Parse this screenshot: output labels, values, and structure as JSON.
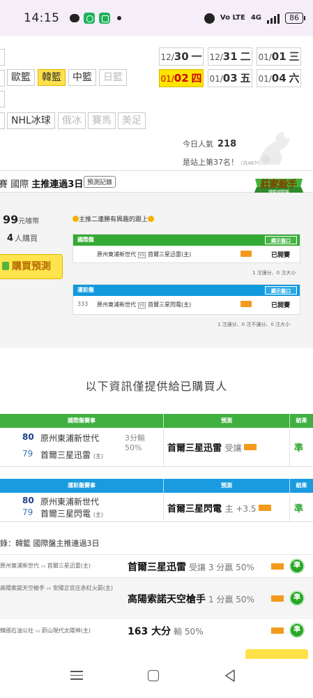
{
  "status_bar": {
    "time": "14:15",
    "net": "Vo LTE",
    "signal": "4G",
    "battery": "86"
  },
  "categories": {
    "row1": [
      {
        "label": "歐籃",
        "state": "normal"
      },
      {
        "label": "韓籃",
        "state": "active"
      },
      {
        "label": "中籃",
        "state": "normal"
      },
      {
        "label": "日籃",
        "state": "disabled"
      }
    ],
    "row3": [
      {
        "label": "NHL冰球",
        "state": "normal"
      },
      {
        "label": "俄冰",
        "state": "disabled"
      },
      {
        "label": "賽馬",
        "state": "disabled"
      },
      {
        "label": "美足",
        "state": "disabled"
      }
    ]
  },
  "dates": [
    {
      "md": "12/",
      "day": "30",
      "wd": "一",
      "active": false
    },
    {
      "md": "12/",
      "day": "31",
      "wd": "二",
      "active": false
    },
    {
      "md": "01/",
      "day": "01",
      "wd": "三",
      "active": false
    },
    {
      "md": "01/",
      "day": "02",
      "wd": "四",
      "active": true
    },
    {
      "md": "01/",
      "day": "03",
      "wd": "五",
      "active": false
    },
    {
      "md": "01/",
      "day": "04",
      "wd": "六",
      "active": false
    }
  ],
  "popularity": {
    "label": "今日人氣",
    "value": "218",
    "rank": "是站上第37名！",
    "rank_sub": "(共4670人)"
  },
  "package": {
    "prefix": "賽 國際",
    "title": "主推連過3日",
    "record_label": "預測記錄",
    "badge_title": "莊家殺手",
    "badge_sub": "韓籃國際盤",
    "price": "99",
    "price_unit": "元噱幣",
    "buyers": "4",
    "buyers_unit": "人購買",
    "buy_label": "購買預測",
    "tagline": "主推二連勝有興趣的跟上",
    "intl": {
      "label": "國際盤",
      "show_label": "顯示盤口",
      "id": "",
      "home": "原州東浦新世代",
      "away": "首爾三星迅雷(主)",
      "status": "已開賽",
      "note": "1 注讓分、0 注大小"
    },
    "lottery": {
      "label": "運彩盤",
      "show_label": "顯示盤口",
      "id": "333",
      "home": "原州東浦新世代",
      "away": "首爾三星閃電(主)",
      "status": "已開賽",
      "note": "1 注讓分、0 注不讓分、0 注大小"
    }
  },
  "notice": "以下資訊僅提供給已購買人",
  "table_headers": {
    "match": "賽事",
    "pick": "預測",
    "result": "結果"
  },
  "intl_table": {
    "title": "國際盤賽事",
    "rows": [
      {
        "num_a": "80",
        "team_a": "原州東浦新世代",
        "num_b": "79",
        "team_b": "首爾三星迅雷",
        "host": "(主)",
        "score": "3分輸",
        "pct": "50%",
        "pick": "首爾三星迅雷",
        "pick_note": "受讓",
        "result": "準"
      }
    ]
  },
  "lottery_table": {
    "title": "運彩盤賽事",
    "rows": [
      {
        "num_a": "80",
        "team_a": "原州東浦新世代",
        "num_b": "79",
        "team_b": "首爾三星閃電",
        "host": "(主)",
        "pick": "首爾三星閃電",
        "pick_note": "主 +3.5",
        "result": "準"
      }
    ]
  },
  "history": {
    "title": "錄：韓籃 國際盤主推連過3日",
    "rows": [
      {
        "match": "原州東浦新世代",
        "vs": "vs",
        "match2": "首爾三星迅雷(主)",
        "pick": "首爾三星迅雷",
        "note": "受讓 3 分贏 50%",
        "result": "準"
      },
      {
        "match": "高陽索諾天空槍手",
        "vs": "vs",
        "match2": "安陽正官庄赤紅火箭(主)",
        "pick": "高陽索諾天空槍手",
        "note": "1 分贏 50%",
        "result": "準"
      },
      {
        "match": "韓國石油公社",
        "vs": "vs",
        "match2": "蔚山現代太陽神(主)",
        "pick": "163 大分",
        "note": "輸 50%",
        "result": "準"
      }
    ]
  },
  "colors": {
    "accent_yellow": "#ffe14a",
    "green": "#3fb040",
    "blue": "#1a9be0",
    "win_green": "#25a826"
  },
  "icons": [
    "chat-bubble-icon",
    "app-icon",
    "app-icon",
    "alarm-icon",
    "signal-icon",
    "battery-icon",
    "menu-icon",
    "home-icon",
    "back-icon"
  ]
}
